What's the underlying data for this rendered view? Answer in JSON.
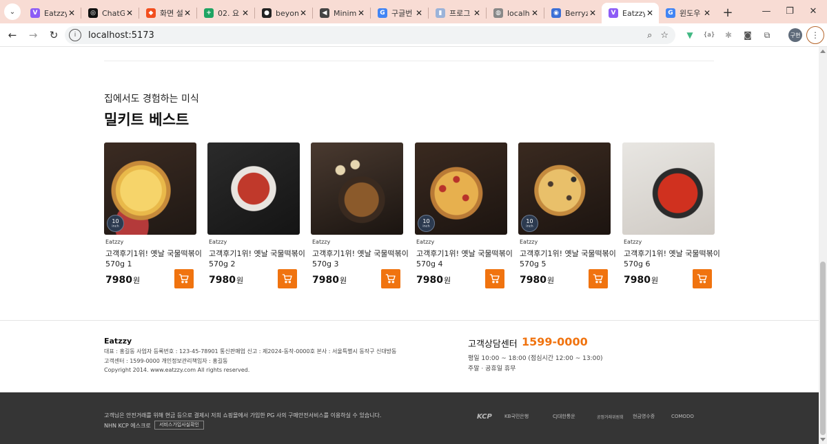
{
  "browser": {
    "tabs": [
      {
        "title": "Eatzzy",
        "icon": "vite-icon",
        "color": "#8c5cf6"
      },
      {
        "title": "ChatGPT",
        "icon": "chatgpt-icon",
        "color": "#111111"
      },
      {
        "title": "화면 설",
        "icon": "figma-icon",
        "color": "#f24e1e"
      },
      {
        "title": "02. 요",
        "icon": "sheets-icon",
        "color": "#1fa463"
      },
      {
        "title": "beyon",
        "icon": "github-icon",
        "color": "#222222"
      },
      {
        "title": "Minim",
        "icon": "minimal-icon",
        "color": "#444444"
      },
      {
        "title": "구글번",
        "icon": "google-icon",
        "color": "#4285f4"
      },
      {
        "title": "프로그",
        "icon": "doc-icon",
        "color": "#9bb3d9"
      },
      {
        "title": "localh",
        "icon": "globe-icon",
        "color": "#888888"
      },
      {
        "title": "Berryz",
        "icon": "berry-icon",
        "color": "#3b6fd6"
      },
      {
        "title": "Eatzzy",
        "icon": "vite-icon",
        "color": "#8c5cf6",
        "active": true
      },
      {
        "title": "윈도우",
        "icon": "google-icon",
        "color": "#4285f4"
      }
    ],
    "tab_close": "✕",
    "new_tab": "+",
    "url": "localhost:5173",
    "profile": "구현"
  },
  "section": {
    "subtitle": "집에서도 경험하는 미식",
    "title": "밀키트 베스트"
  },
  "products": [
    {
      "brand": "Eatzzy",
      "name_line1": "고객후기1위! 옛날 국물떡볶이",
      "name_line2": "570g 1",
      "price": "7980",
      "currency": "원",
      "badge_num": "10",
      "badge_unit": "inch",
      "image": "pizza-cheese"
    },
    {
      "brand": "Eatzzy",
      "name_line1": "고객후기1위! 옛날 국물떡볶이",
      "name_line2": "570g 2",
      "price": "7980",
      "currency": "원",
      "badge_num": "",
      "badge_unit": "",
      "image": "tteokbokki-bowl"
    },
    {
      "brand": "Eatzzy",
      "name_line1": "고객후기1위! 옛날 국물떡볶이",
      "name_line2": "570g 3",
      "price": "7980",
      "currency": "원",
      "badge_num": "",
      "badge_unit": "",
      "image": "oden-skewers"
    },
    {
      "brand": "Eatzzy",
      "name_line1": "고객후기1위! 옛날 국물떡볶이",
      "name_line2": "570g 4",
      "price": "7980",
      "currency": "원",
      "badge_num": "10",
      "badge_unit": "inch",
      "image": "pizza-pepperoni"
    },
    {
      "brand": "Eatzzy",
      "name_line1": "고객후기1위! 옛날 국물떡볶이",
      "name_line2": "570g 5",
      "price": "7980",
      "currency": "원",
      "badge_num": "10",
      "badge_unit": "inch",
      "image": "pizza-mushroom"
    },
    {
      "brand": "Eatzzy",
      "name_line1": "고객후기1위! 옛날 국물떡볶이",
      "name_line2": "570g 6",
      "price": "7980",
      "currency": "원",
      "badge_num": "",
      "badge_unit": "",
      "image": "tteokbokki-pan"
    }
  ],
  "footer": {
    "brand": "Eatzzy",
    "line1": "대표 : 홍길동     사업자 등록번호 : 123-45-78901     통신판매업 신고 : 제2024-동작-0000호 본사 : 서울특별시 동작구 신대방동",
    "line2": "고객센터 : 1599-0000     개인정보관리책임자 : 홍길동",
    "line3": "Copyright 2014. www.eatzzy.com All rights reserved.",
    "cs_title": "고객상담센터",
    "cs_phone": "1599-0000",
    "cs_hours": "평일 10:00 ~ 18:00 (점심시간 12:00 ~ 13:00)",
    "cs_closed": "주말 · 공휴일 휴무",
    "notice": "고객님은 안전거래를 위해 현금 등으로 결제시 저희 쇼핑몰에서 가입한 PG 사의 구매안전서비스를 이용하실 수 있습니다.",
    "kcp_label": "NHN KCP 에스크로",
    "kcp_button": "서비스가입사실확인",
    "logos": [
      "KCP",
      "KB국민은행",
      "CJ대한통운",
      "공정거래위원회",
      "현금영수증",
      "COMODO"
    ]
  },
  "colors": {
    "accent": "#f0730f",
    "tabstrip": "#f8dcd4",
    "footer_dark": "#353535"
  }
}
